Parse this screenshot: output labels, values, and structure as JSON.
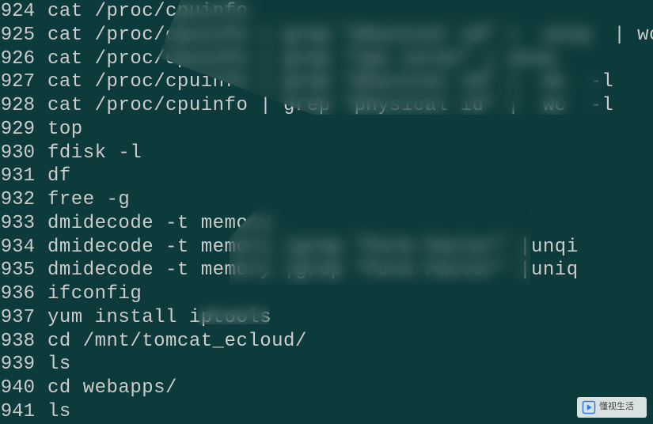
{
  "terminal": {
    "lines": [
      {
        "num": "924",
        "cmd": "cat /proc/cpuinfo"
      },
      {
        "num": "925",
        "cmd": "cat /proc/cpuinfo | grep \"physical id\" |  uniq  | wc -l"
      },
      {
        "num": "926",
        "cmd": "cat /proc/cpuinfo | grep \"cpu cores\" | uniq"
      },
      {
        "num": "927",
        "cmd": "cat /proc/cpuinfo | grep \"physical id\" |  wc  -l"
      },
      {
        "num": "928",
        "cmd": "cat /proc/cpuinfo | grep \"physical id\" |  wc  -l"
      },
      {
        "num": "929",
        "cmd": "top"
      },
      {
        "num": "930",
        "cmd": "fdisk -l"
      },
      {
        "num": "931",
        "cmd": "df"
      },
      {
        "num": "932",
        "cmd": "free -g"
      },
      {
        "num": "933",
        "cmd": "dmidecode -t memory"
      },
      {
        "num": "934",
        "cmd": "dmidecode -t memory |grep \"Form Factor\" |unqi"
      },
      {
        "num": "935",
        "cmd": "dmidecode -t memory |grep \"Form Factor\" |uniq"
      },
      {
        "num": "936",
        "cmd": "ifconfig"
      },
      {
        "num": "937",
        "cmd": "yum install iptools"
      },
      {
        "num": "938",
        "cmd": "cd /mnt/tomcat_ecloud/"
      },
      {
        "num": "939",
        "cmd": "ls"
      },
      {
        "num": "940",
        "cmd": "cd webapps/"
      },
      {
        "num": "941",
        "cmd": "ls"
      }
    ]
  },
  "watermark": {
    "text": "懂视生活"
  }
}
